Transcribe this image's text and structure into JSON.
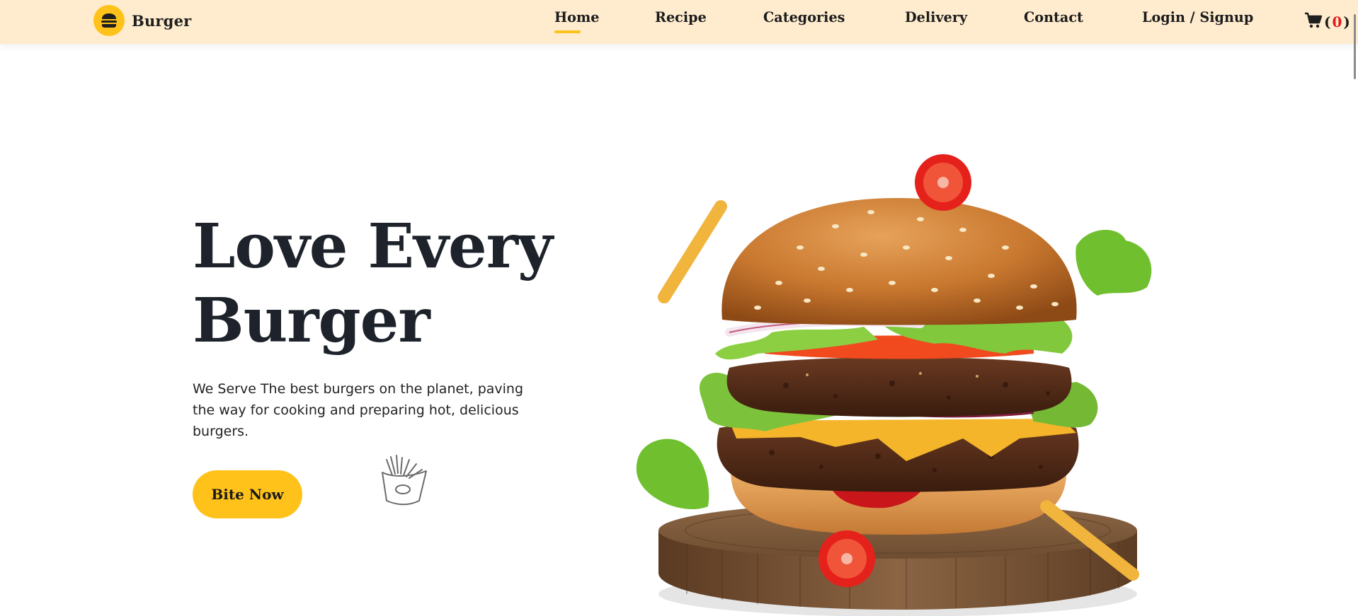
{
  "brand": {
    "name": "Burger",
    "icon": "burger-logo-icon",
    "accent": "#ffc21a"
  },
  "nav": {
    "items": [
      {
        "label": "Home",
        "active": true
      },
      {
        "label": "Recipe",
        "active": false
      },
      {
        "label": "Categories",
        "active": false
      },
      {
        "label": "Delivery",
        "active": false
      },
      {
        "label": "Contact",
        "active": false
      },
      {
        "label": "Login / Signup",
        "active": false
      }
    ],
    "background": "#ffeccf"
  },
  "cart": {
    "icon": "cart-icon",
    "open": "(",
    "count": "0",
    "close": ")"
  },
  "hero": {
    "title_line1": "Love Every",
    "title_line2": "Burger",
    "description": "We Serve The best burgers on the planet, paving the way for cooking and preparing hot, delicious burgers.",
    "cta_label": "Bite Now"
  },
  "colors": {
    "accent": "#ffc21a",
    "cart_count": "#e01b1b",
    "text": "#1e232b"
  }
}
